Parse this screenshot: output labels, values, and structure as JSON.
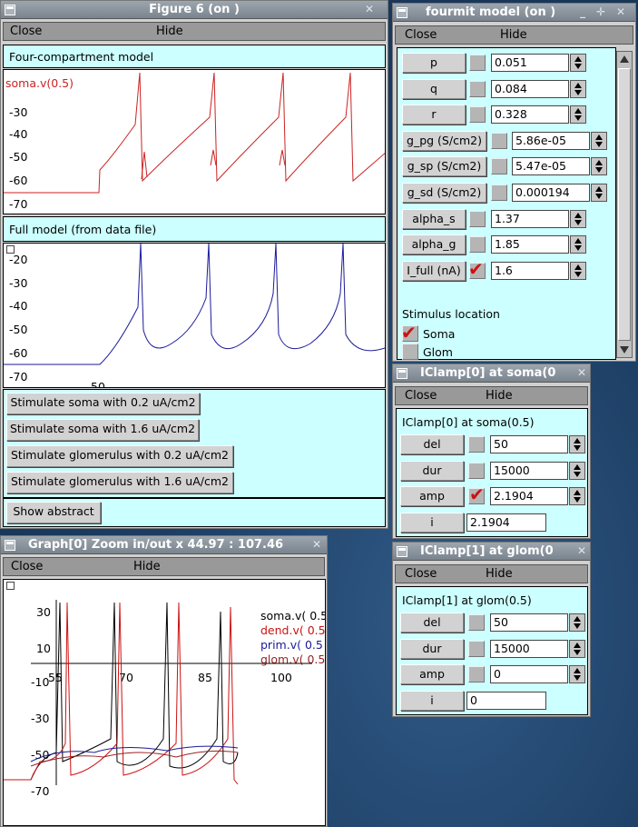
{
  "fig6": {
    "title": "Figure 6 (on )",
    "close": "Close",
    "hide": "Hide",
    "plot1": {
      "label": "Four-compartment model",
      "var": "soma.v(0.5)",
      "yticks": [
        "-30",
        "-40",
        "-50",
        "-60",
        "-70"
      ],
      "color": "#cc2222"
    },
    "plot2": {
      "label": "Full model (from data file)",
      "yticks": [
        "-20",
        "-30",
        "-40",
        "-50",
        "-60",
        "-70"
      ],
      "xticks": [
        "50"
      ],
      "color": "#1a1a99"
    },
    "stim_buttons": [
      "Stimulate soma with 0.2 uA/cm2",
      "Stimulate soma with 1.6 uA/cm2",
      "Stimulate glomerulus with 0.2 uA/cm2",
      "Stimulate glomerulus with 1.6 uA/cm2"
    ],
    "abstract": "Show abstract"
  },
  "fourmit": {
    "title": "fourmit model (on )",
    "close": "Close",
    "hide": "Hide",
    "params": [
      {
        "label": "p",
        "value": "0.051"
      },
      {
        "label": "q",
        "value": "0.084"
      },
      {
        "label": "r",
        "value": "0.328"
      },
      {
        "label": "g_pg (S/cm2)",
        "value": "5.86e-05"
      },
      {
        "label": "g_sp (S/cm2)",
        "value": "5.47e-05"
      },
      {
        "label": "g_sd (S/cm2)",
        "value": "0.000194"
      },
      {
        "label": "alpha_s",
        "value": "1.37"
      },
      {
        "label": "alpha_g",
        "value": "1.85"
      },
      {
        "label": "I_full (nA)",
        "value": "1.6"
      }
    ],
    "stim_location": "Stimulus location",
    "soma": "Soma",
    "glom": "Glom"
  },
  "iclamp0": {
    "title": "IClamp[0] at soma(0",
    "close": "Close",
    "hide": "Hide",
    "heading": "IClamp[0] at soma(0.5)",
    "fields": [
      {
        "label": "del",
        "value": "50"
      },
      {
        "label": "dur",
        "value": "15000"
      },
      {
        "label": "amp",
        "value": "2.1904"
      }
    ],
    "i_label": "i",
    "i_value": "2.1904"
  },
  "iclamp1": {
    "title": "IClamp[1] at glom(0",
    "close": "Close",
    "hide": "Hide",
    "heading": "IClamp[1] at glom(0.5)",
    "fields": [
      {
        "label": "del",
        "value": "50"
      },
      {
        "label": "dur",
        "value": "15000"
      },
      {
        "label": "amp",
        "value": "0"
      }
    ],
    "i_label": "i",
    "i_value": "0"
  },
  "graph0": {
    "title": "Graph[0] Zoom in/out x 44.97 : 107.46",
    "close": "Close",
    "hide": "Hide",
    "yticks": [
      "30",
      "10",
      "-10",
      "-30",
      "-50",
      "-70"
    ],
    "xticks": [
      "55",
      "70",
      "85",
      "100"
    ],
    "legend": [
      {
        "name": "soma.v( 0.5",
        "color": "#000000"
      },
      {
        "name": "dend.v( 0.5",
        "color": "#cc1111"
      },
      {
        "name": "prim.v( 0.5",
        "color": "#1a1a99"
      },
      {
        "name": "glom.v( 0.5",
        "color": "#992222"
      }
    ]
  }
}
